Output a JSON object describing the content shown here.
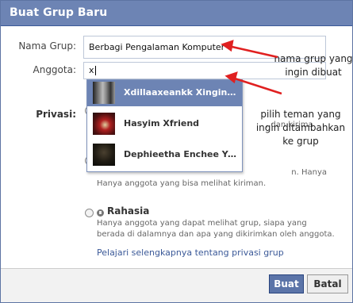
{
  "dialog": {
    "title": "Buat Grup Baru"
  },
  "form": {
    "group_name_label": "Nama Grup:",
    "group_name_value": "Berbagi Pengalaman Komputer",
    "members_label": "Anggota:",
    "members_value": "x",
    "privacy_label": "Privasi:"
  },
  "suggestions": [
    {
      "name": "Xdillaaxeankk Xingindt...",
      "selected": true
    },
    {
      "name": "Hasyim Xfriend",
      "selected": false
    },
    {
      "name": "Dephieetha Enchee Yur...",
      "selected": false
    }
  ],
  "privacy": {
    "option1_partial_desc": ", dan kirima",
    "option2_desc": "Hanya anggota yang bisa melihat kiriman.",
    "option2_desc_pre": "n. Hanya",
    "option3_title": "Rahasia",
    "option3_desc": "Hanya anggota yang dapat melihat grup, siapa yang berada di dalamnya dan apa yang dikirimkan oleh anggota.",
    "learn_more_link": "Pelajari selengkapnya tentang privasi grup"
  },
  "buttons": {
    "create": "Buat",
    "cancel": "Batal"
  },
  "annotations": {
    "note1": "nama grup yang ingin dibuat",
    "note2": "pilih teman yang ingin ditambahkan ke grup",
    "arrow_color": "#e02020"
  },
  "colors": {
    "titlebar": "#6d84b4",
    "accent": "#3b5998",
    "selected_row": "#6d84b4"
  }
}
